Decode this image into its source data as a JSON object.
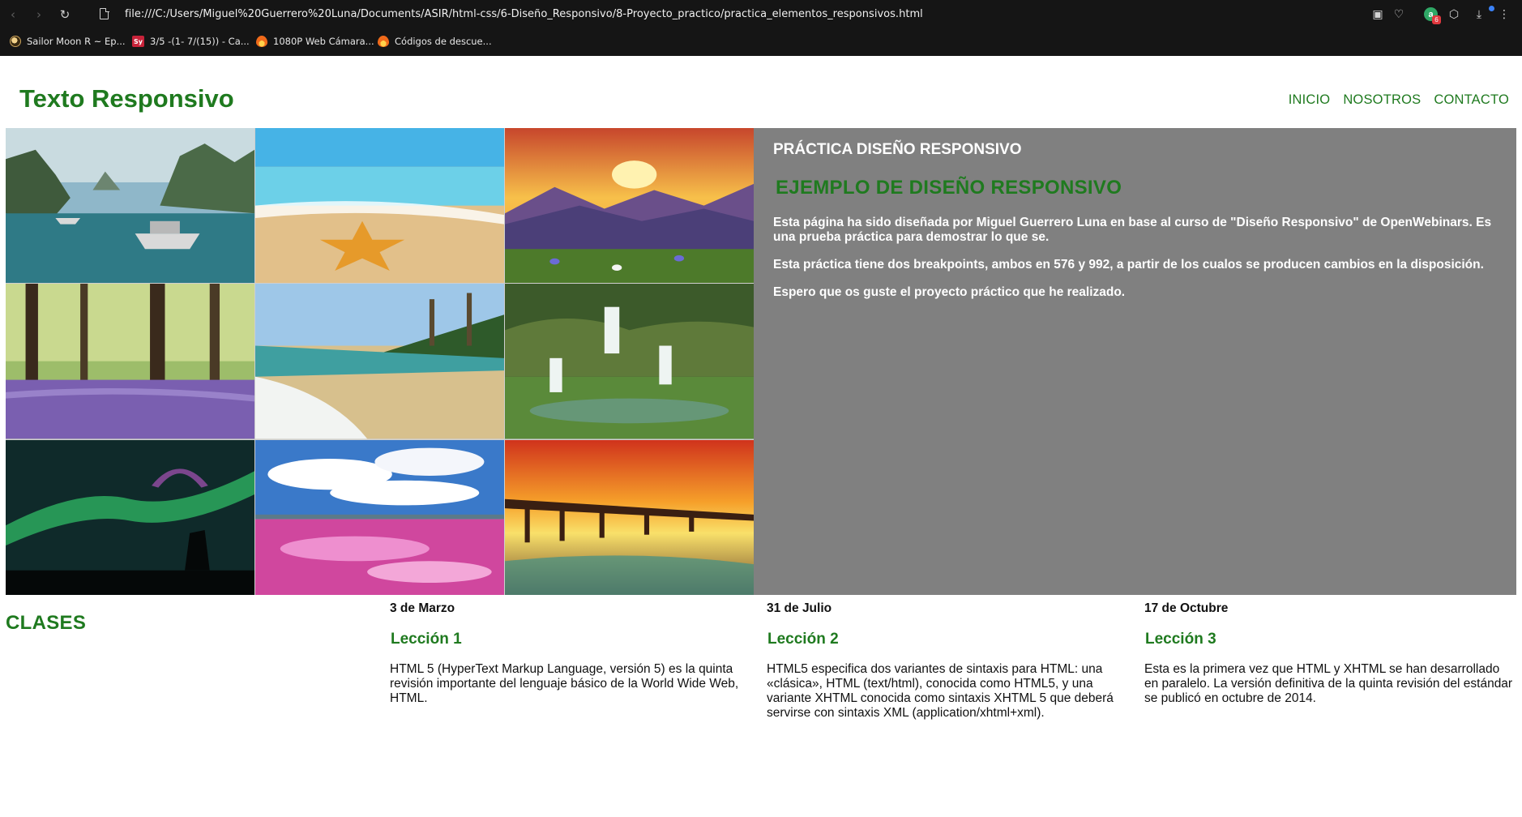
{
  "browser": {
    "url": "file:///C:/Users/Miguel%20Guerrero%20Luna/Documents/ASIR/html-css/6-Diseño_Responsivo/8-Proyecto_practico/practica_elementos_responsivos.html",
    "extension_badge": "a",
    "extension_count": "6",
    "bookmarks": [
      {
        "label": "Sailor Moon R ~ Ep...",
        "icon": "moon-favicon"
      },
      {
        "label": "3/5 -(1- 7/(15)) - Ca...",
        "icon": "sy-favicon",
        "icon_text": "Sy"
      },
      {
        "label": "1080P Web Cámara...",
        "icon": "fire-favicon"
      },
      {
        "label": "Códigos de descue...",
        "icon": "fire-favicon"
      }
    ]
  },
  "header": {
    "title": "Texto Responsivo",
    "nav": [
      "INICIO",
      "NOSOTROS",
      "CONTACTO"
    ]
  },
  "gallery": {
    "images": [
      "bay-boats",
      "beach-starfish",
      "mountain-sunset",
      "bluebell-forest",
      "tropical-beach",
      "waterfall-rocks",
      "aurora-night",
      "pink-sky-reflection",
      "pier-sunset"
    ]
  },
  "info": {
    "heading": "PRÁCTICA DISEÑO RESPONSIVO",
    "subheading": "EJEMPLO DE DISEÑO RESPONSIVO",
    "paragraphs": [
      "Esta página ha sido diseñada por Miguel Guerrero Luna en base al curso de \"Diseño Responsivo\" de OpenWebinars. Es una prueba práctica para demostrar lo que se.",
      "Esta práctica tiene dos breakpoints, ambos en 576 y 992, a partir de los cualos se producen cambios en la disposición.",
      "Espero que os guste el proyecto práctico que he realizado."
    ]
  },
  "classes": {
    "title": "CLASES",
    "lessons": [
      {
        "date": "3 de Marzo",
        "title": "Lección 1",
        "text": "HTML 5 (HyperText Markup Language, versión 5) es la quinta revisión importante del lenguaje básico de la World Wide Web, HTML."
      },
      {
        "date": "31 de Julio",
        "title": "Lección 2",
        "text": "HTML5 especifica dos variantes de sintaxis para HTML: una «clásica», HTML (text/html), conocida como HTML5, y una variante XHTML conocida como sintaxis XHTML 5 que deberá servirse con sintaxis XML (application/xhtml+xml)."
      },
      {
        "date": "17 de Octubre",
        "title": "Lección 3",
        "text": "Esta es la primera vez que HTML y XHTML se han desarrollado en paralelo. La versión definitiva de la quinta revisión del estándar se publicó en octubre de 2014."
      }
    ]
  }
}
